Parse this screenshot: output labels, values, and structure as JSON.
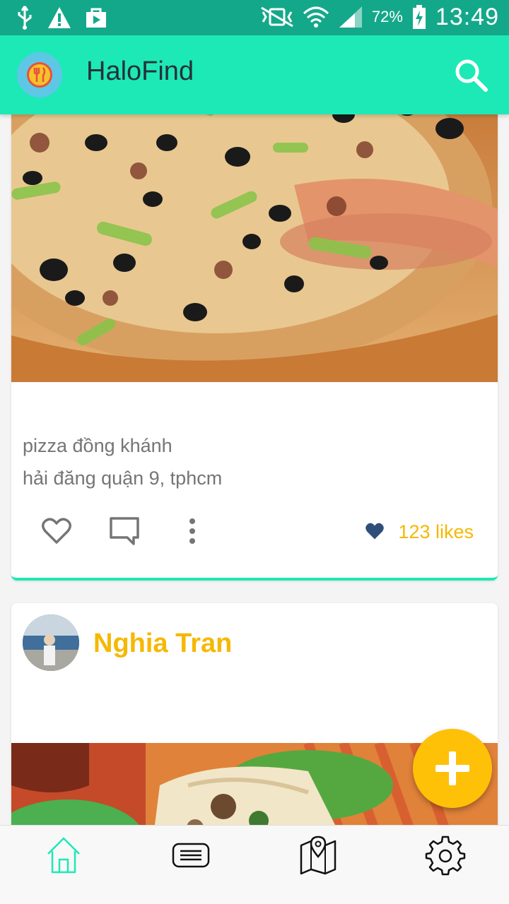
{
  "status_bar": {
    "battery": "72%",
    "time": "13:49"
  },
  "app_bar": {
    "title": "HaloFind"
  },
  "post1": {
    "title": "pizza đồng khánh",
    "address": "hải đăng quận 9, tphcm",
    "likes": "123 likes"
  },
  "post2": {
    "author": "Nghia Tran"
  },
  "colors": {
    "status_bar": "#14a88a",
    "app_bar": "#1de9b6",
    "accent": "#f5b800",
    "fab": "#ffc107",
    "heart": "#2f4f7a"
  },
  "icons": {
    "search": "search-icon",
    "like": "heart-outline-icon",
    "comment": "comment-icon",
    "more": "more-vertical-icon",
    "likes_badge": "heart-filled-icon",
    "fab": "plus-icon",
    "nav": [
      "home-icon",
      "list-icon",
      "map-icon",
      "settings-icon"
    ]
  },
  "bottom_nav": {
    "active": "home"
  }
}
